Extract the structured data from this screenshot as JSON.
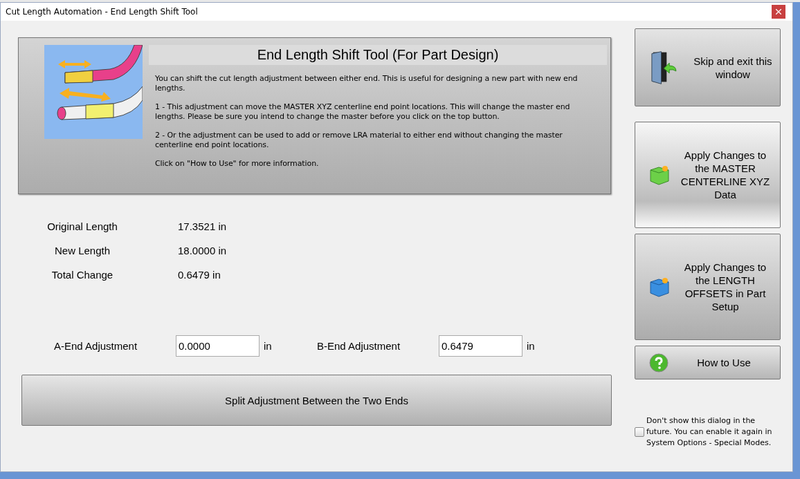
{
  "window": {
    "title": "Cut Length Automation - End Length Shift Tool"
  },
  "header": {
    "title": "End Length Shift Tool (For Part Design)",
    "paragraphs": [
      "You can shift the cut length adjustment between either end. This is useful for designing a new part with new end lengths.",
      "1 - This adjustment can move the MASTER XYZ centerline end point locations. This will change the master end lengths. Please be sure you intend to change the master before you click on the top button.",
      "2 - Or the adjustment can be used to add or remove LRA material to either end without changing the master centerline end point locations.",
      "Click on \"How to Use\" for more information."
    ]
  },
  "stats": [
    {
      "label": "Original Length",
      "value": "17.3521 in"
    },
    {
      "label": "New Length",
      "value": "18.0000 in"
    },
    {
      "label": "Total Change",
      "value": "0.6479 in"
    }
  ],
  "adjustments": [
    {
      "label": "A-End Adjustment",
      "value": "0.0000",
      "unit": "in"
    },
    {
      "label": "B-End Adjustment",
      "value": "0.6479",
      "unit": "in"
    }
  ],
  "split_button": "Split Adjustment Between the Two Ends",
  "side_buttons": [
    {
      "kind": "exit",
      "label": "Skip and exit this window"
    },
    {
      "kind": "master",
      "label": "Apply Changes to the MASTER CENTERLINE XYZ Data"
    },
    {
      "kind": "offsets",
      "label": "Apply Changes to the LENGTH OFFSETS in Part Setup"
    },
    {
      "kind": "help",
      "label": "How to Use"
    }
  ],
  "dont_show": {
    "label": "Don't show this dialog in the future. You can enable it again in System Options - Special Modes.",
    "checked": false
  }
}
